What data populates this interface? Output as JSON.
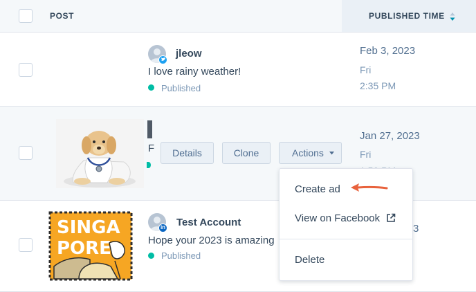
{
  "table": {
    "header": {
      "post_label": "POST",
      "published_label": "PUBLISHED TIME"
    },
    "rows": [
      {
        "account": "jleow",
        "network": "twitter",
        "message": "I love rainy weather!",
        "status": "Published",
        "date": "Feb 3, 2023",
        "weekday": "Fri",
        "time": "2:35 PM"
      },
      {
        "account": "",
        "network": "",
        "message": "F",
        "status": "",
        "date": "Jan 27, 2023",
        "weekday": "Fri",
        "time": "1:50 PM"
      },
      {
        "account": "Test Account",
        "network": "linkedin",
        "message": "Hope your 2023 is amazing",
        "status": "Published",
        "date": "",
        "weekday": "",
        "time": "",
        "time_partial": "3"
      }
    ]
  },
  "row_actions": {
    "details": "Details",
    "clone": "Clone",
    "actions": "Actions"
  },
  "actions_menu": {
    "items": [
      "Create ad",
      "View on Facebook",
      "Delete"
    ]
  },
  "colors": {
    "status_published": "#00bda5",
    "annotation_arrow": "#e8623c",
    "accent": "#0091ae"
  }
}
